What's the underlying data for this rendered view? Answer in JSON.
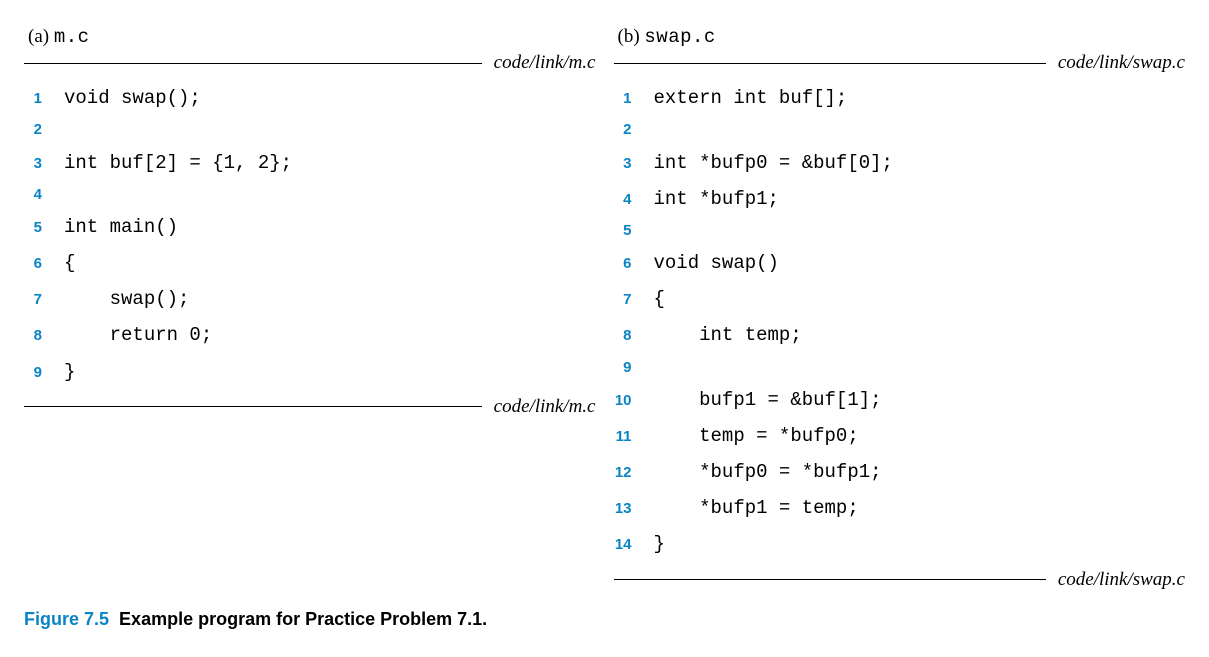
{
  "left": {
    "label_part": "(a) ",
    "label_fname": "m.c",
    "path_top": "code/link/m.c",
    "path_bottom": "code/link/m.c",
    "lines": [
      "void swap();",
      "",
      "int buf[2] = {1, 2};",
      "",
      "int main()",
      "{",
      "    swap();",
      "    return 0;",
      "}"
    ]
  },
  "right": {
    "label_part": "(b) ",
    "label_fname": "swap.c",
    "path_top": "code/link/swap.c",
    "path_bottom": "code/link/swap.c",
    "lines": [
      "extern int buf[];",
      "",
      "int *bufp0 = &buf[0];",
      "int *bufp1;",
      "",
      "void swap()",
      "{",
      "    int temp;",
      "",
      "    bufp1 = &buf[1];",
      "    temp = *bufp0;",
      "    *bufp0 = *bufp1;",
      "    *bufp1 = temp;",
      "}"
    ]
  },
  "caption": {
    "fig": "Figure 7.5",
    "title": "Example program for Practice Problem 7.1."
  }
}
